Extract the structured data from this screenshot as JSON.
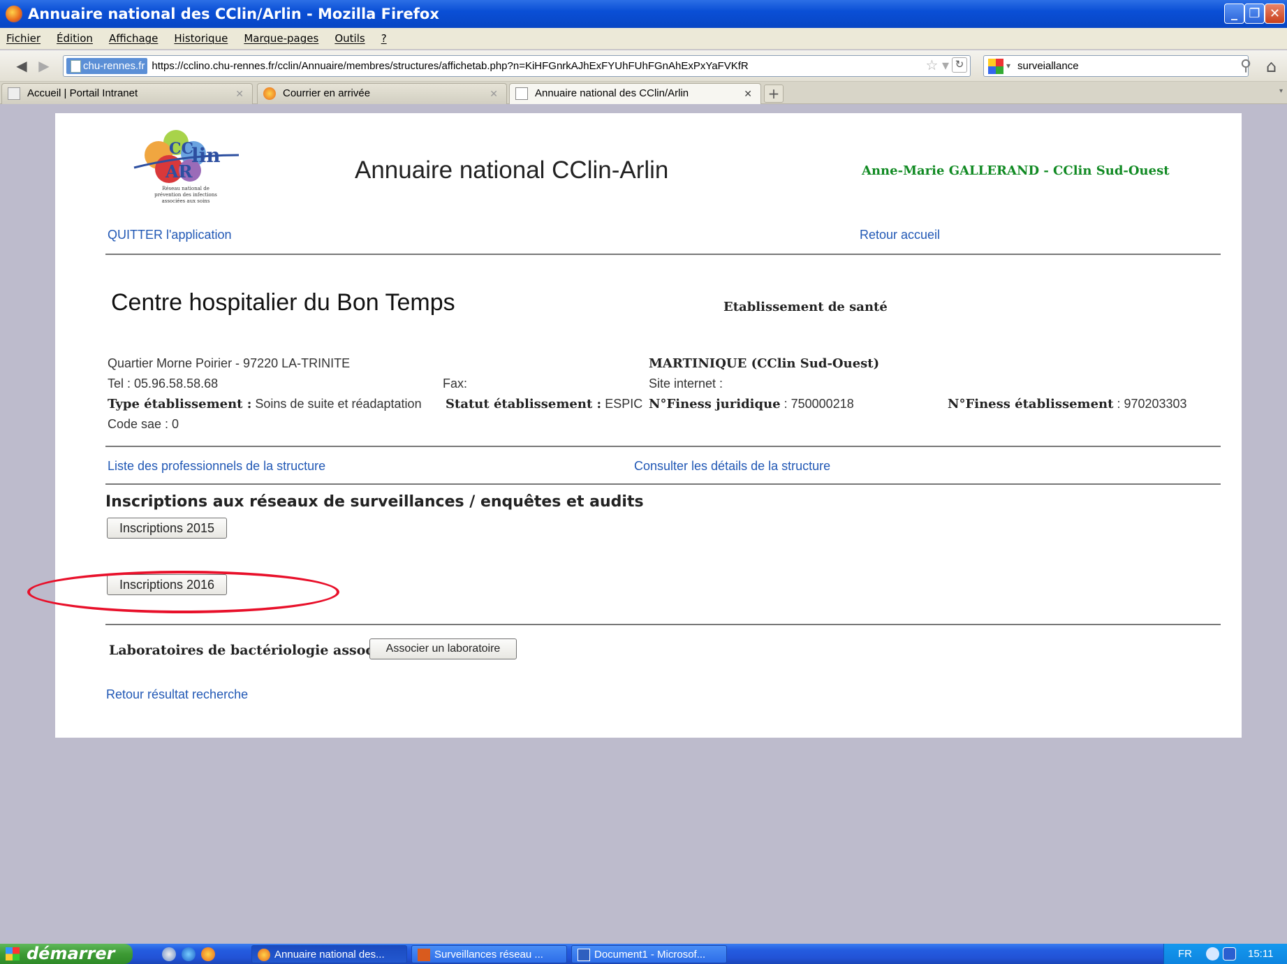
{
  "window": {
    "title": "Annuaire national des CClin/Arlin - Mozilla Firefox",
    "controls": [
      "minimize",
      "restore",
      "close"
    ]
  },
  "menu": [
    "Fichier",
    "Édition",
    "Affichage",
    "Historique",
    "Marque-pages",
    "Outils",
    "?"
  ],
  "nav": {
    "site_badge": "chu-rennes.fr",
    "url": "https://cclino.chu-rennes.fr/cclin/Annuaire/membres/structures/affichetab.php?n=KiHFGnrkAJhExFYUhFUhFGnAhExPxYaFVKfR",
    "search_value": "surveiallance"
  },
  "tabs": [
    {
      "label": "Accueil | Portail Intranet",
      "active": false
    },
    {
      "label": "Courrier en arrivée",
      "active": false
    },
    {
      "label": "Annuaire national des CClin/Arlin",
      "active": true
    }
  ],
  "page": {
    "logo_caption": "Réseau national de prévention des infections associées aux soins",
    "app_title": "Annuaire national CClin-Arlin",
    "user": "Anne-Marie GALLERAND - CClin Sud-Ouest",
    "quit_link": "QUITTER l'application",
    "home_link": "Retour accueil",
    "structure_name": "Centre hospitalier du Bon Temps",
    "structure_type": "Etablissement de santé",
    "address": "Quartier Morne Poirier - 97220 LA-TRINITE",
    "region": "MARTINIQUE (CClin Sud-Ouest)",
    "tel": "Tel : 05.96.58.58.68",
    "fax": "Fax:",
    "website": "Site internet :",
    "type_label": "Type établissement :",
    "type_value": " Soins de suite et réadaptation",
    "statut_label": "Statut établissement :",
    "statut_value": " ESPIC",
    "finess_jur_label": "N°Finess juridique",
    "finess_jur_value": " : 750000218",
    "finess_etab_label": "N°Finess établissement",
    "finess_etab_value": " : 970203303",
    "code_sae": "Code sae : 0",
    "professionals_link": "Liste des professionnels de la structure",
    "details_link": "Consulter les détails de la structure",
    "inscriptions_heading": "Inscriptions aux réseaux de surveillances / enquêtes et audits",
    "btn_2015": "Inscriptions 2015",
    "btn_2016": "Inscriptions 2016",
    "labs_label": "Laboratoires de bactériologie associés :",
    "labs_button": "Associer un laboratoire",
    "back_link": "Retour résultat recherche"
  },
  "taskbar": {
    "start": "démarrer",
    "tasks": [
      "Annuaire national des...",
      "Surveillances réseau ...",
      "Document1 - Microsof..."
    ],
    "lang": "FR",
    "clock": "15:11"
  },
  "colors": {
    "link": "#2158b5",
    "user": "#118a23",
    "highlight_ellipse": "#e8102a",
    "desktop_bg": "#bdbbcc"
  }
}
